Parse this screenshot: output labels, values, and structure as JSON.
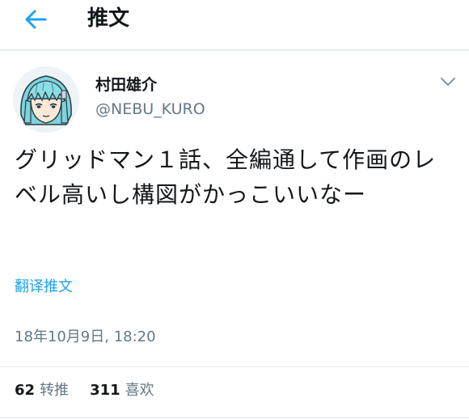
{
  "header": {
    "title": "推文",
    "back_icon": "arrow-left-icon"
  },
  "tweet": {
    "display_name": "村田雄介",
    "handle": "@NEBU_KURO",
    "text": "グリッドマン１話、全編通して作画のレベル高いし構図がかっこいいなー",
    "translate_label": "翻译推文",
    "timestamp": "18年10月9日, 18:20",
    "retweet_count": "62",
    "retweet_label": "转推",
    "like_count": "311",
    "like_label": "喜欢"
  },
  "colors": {
    "accent": "#1da1f2",
    "secondary_text": "#657786",
    "primary_text": "#14171a",
    "divider": "#e1e8ed"
  }
}
